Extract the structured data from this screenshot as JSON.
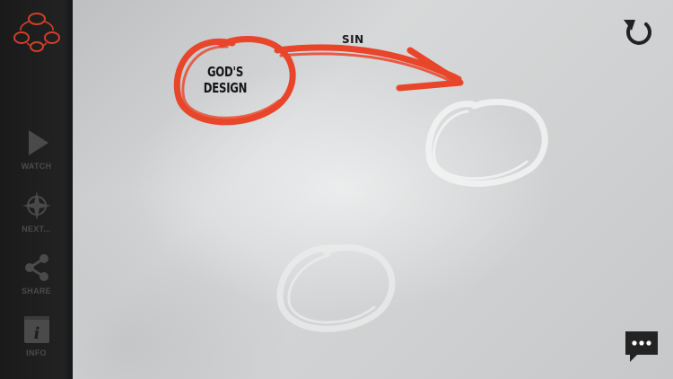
{
  "sidebar": {
    "logo_icon": "cycle-diagram-icon",
    "items": [
      {
        "label": "WATCH",
        "icon": "play-icon"
      },
      {
        "label": "NEXT...",
        "icon": "compass-icon"
      },
      {
        "label": "SHARE",
        "icon": "share-icon"
      },
      {
        "label": "INFO",
        "icon": "info-icon"
      }
    ]
  },
  "canvas": {
    "circle_label_line1": "GOD'S",
    "circle_label_line2": "DESIGN",
    "arrow_label": "SIN",
    "reset_icon": "reset-icon",
    "chat_icon": "chat-bubble-icon"
  },
  "colors": {
    "accent": "#e8452a",
    "sidebar": "#1e1e1e",
    "icon_dim": "#4a4a4a"
  }
}
